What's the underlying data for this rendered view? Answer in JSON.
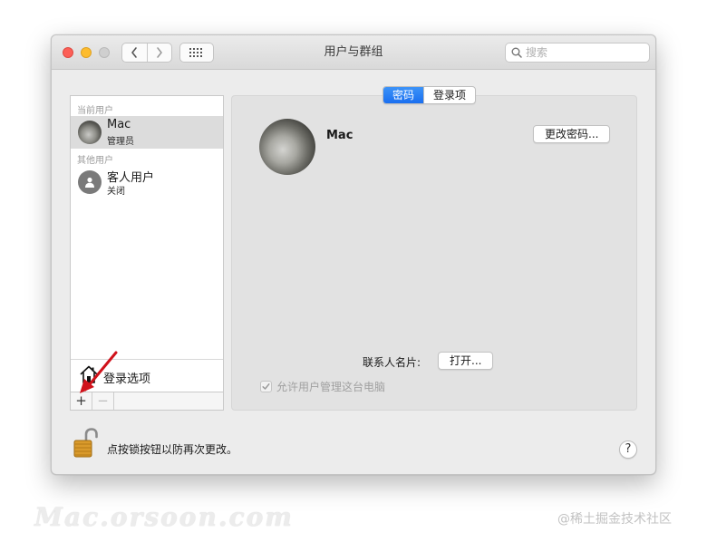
{
  "window": {
    "title": "用户与群组",
    "search_placeholder": "搜索"
  },
  "sidebar": {
    "current_header": "当前用户",
    "current_user": {
      "name": "Mac",
      "role": "管理员"
    },
    "other_header": "其他用户",
    "other_users": [
      {
        "name": "客人用户",
        "status": "关闭"
      }
    ],
    "login_options_label": "登录选项",
    "add_label": "+",
    "remove_label": "−"
  },
  "tabs": [
    {
      "label": "密码",
      "active": true
    },
    {
      "label": "登录项",
      "active": false
    }
  ],
  "detail": {
    "user_name": "Mac",
    "change_password_button": "更改密码...",
    "contact_card_label": "联系人名片:",
    "open_button": "打开...",
    "allow_admin_label": "允许用户管理这台电脑",
    "allow_admin_checked": true
  },
  "footer": {
    "lock_text": "点按锁按钮以防再次更改。",
    "help_label": "?"
  },
  "watermarks": {
    "left": "Mac.orsoon.com",
    "right": "@稀土掘金技术社区"
  },
  "colors": {
    "accent": "#1a6ff0",
    "arrow": "#d0121b"
  }
}
